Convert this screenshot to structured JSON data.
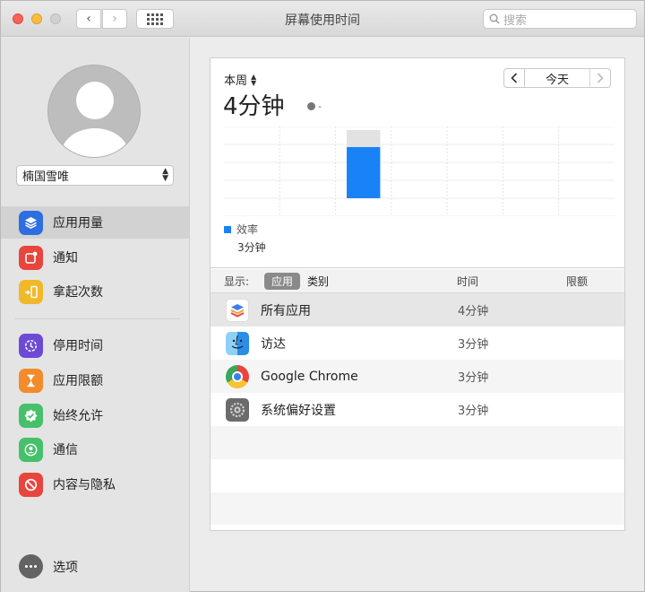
{
  "window": {
    "title": "屏幕使用时间"
  },
  "toolbar": {
    "back": "‹",
    "forward": "›",
    "search_placeholder": "搜索"
  },
  "user": {
    "name": "楠国雪唯"
  },
  "sidebar": {
    "items": [
      {
        "label": "应用用量",
        "icon": "layers-icon",
        "color": "#2d6ee0",
        "active": true
      },
      {
        "label": "通知",
        "icon": "notification-icon",
        "color": "#e8453c"
      },
      {
        "label": "拿起次数",
        "icon": "pickup-icon",
        "color": "#f0b82a"
      },
      {
        "label": "停用时间",
        "icon": "downtime-icon",
        "color": "#6d4ad6"
      },
      {
        "label": "应用限额",
        "icon": "hourglass-icon",
        "color": "#f28b2b"
      },
      {
        "label": "始终允许",
        "icon": "checkmark-badge-icon",
        "color": "#46c06b"
      },
      {
        "label": "通信",
        "icon": "contact-icon",
        "color": "#46c06b"
      },
      {
        "label": "内容与隐私",
        "icon": "no-entry-icon",
        "color": "#e8453c"
      }
    ],
    "options_label": "选项"
  },
  "summary": {
    "period": "本周",
    "total": "4分钟",
    "delta": "-",
    "nav_today": "今天"
  },
  "chart_data": {
    "type": "bar",
    "days": 7,
    "stacked": true,
    "series": [
      {
        "name": "效率",
        "color": "#1a82f7",
        "values": [
          0,
          0,
          3,
          0,
          0,
          0,
          0
        ]
      },
      {
        "color": "#e2e2e2",
        "values": [
          0,
          0,
          1,
          0,
          0,
          0,
          0
        ]
      }
    ],
    "legend": [
      {
        "name": "效率",
        "value": "3分钟"
      }
    ]
  },
  "list": {
    "show_label": "显示:",
    "seg_app": "应用",
    "seg_category": "类别",
    "col_time": "时间",
    "col_limit": "限额",
    "rows": [
      {
        "name": "所有应用",
        "time": "4分钟",
        "icon": "layers-icon"
      },
      {
        "name": "访达",
        "time": "3分钟",
        "icon": "finder-icon"
      },
      {
        "name": "Google Chrome",
        "time": "3分钟",
        "icon": "chrome-icon"
      },
      {
        "name": "系统偏好设置",
        "time": "3分钟",
        "icon": "system-preferences-icon"
      }
    ]
  }
}
